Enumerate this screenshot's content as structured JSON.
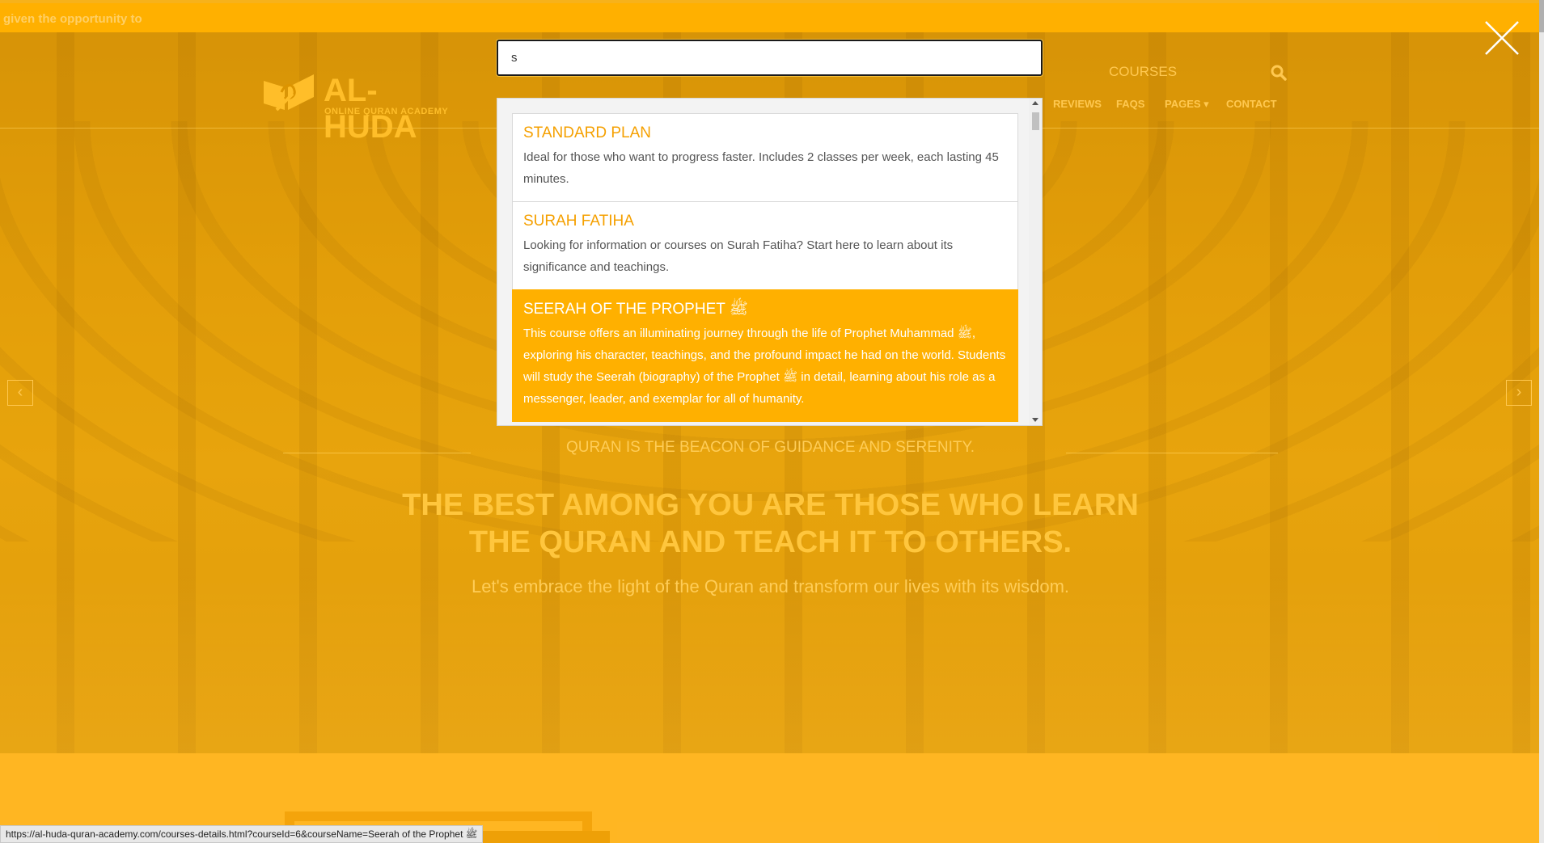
{
  "page": {
    "top_strip_text": "given the opportunity to",
    "logo": {
      "name": "AL-HUDA",
      "tagline": "ONLINE QURAN ACADEMY"
    },
    "nav": {
      "courses": "COURSES",
      "items": [
        {
          "label": "REVIEWS"
        },
        {
          "label": "FAQS"
        },
        {
          "label": "PAGES ▾"
        },
        {
          "label": "CONTACT"
        }
      ]
    },
    "hero": {
      "tagline": "QURAN IS THE BEACON OF GUIDANCE AND SERENITY.",
      "headline_line1": "THE BEST AMONG YOU ARE THOSE WHO LEARN",
      "headline_line2": "THE QURAN AND TEACH IT TO OTHERS.",
      "subline": "Let's embrace the light of the Quran and transform our lives with its wisdom.",
      "prev_arrow": "‹",
      "next_arrow": "›"
    }
  },
  "search": {
    "query": "s",
    "results": [
      {
        "title": "STANDARD PLAN",
        "description": "Ideal for those who want to progress faster. Includes 2 classes per week, each lasting 45 minutes.",
        "active": false
      },
      {
        "title": "SURAH FATIHA",
        "description": "Looking for information or courses on Surah Fatiha? Start here to learn about its significance and teachings.",
        "active": false
      },
      {
        "title": "SEERAH OF THE PROPHET ﷺ",
        "description": "This course offers an illuminating journey through the life of Prophet Muhammad ﷺ, exploring his character, teachings, and the profound impact he had on the world. Students will study the Seerah (biography) of the Prophet ﷺ in detail, learning about his role as a messenger, leader, and exemplar for all of humanity.",
        "active": true
      }
    ]
  },
  "status_bar": {
    "url": "https://al-huda-quran-academy.com/courses-details.html?courseId=6&courseName=Seerah of the Prophet ﷺ"
  },
  "colors": {
    "accent": "#ffb000",
    "result_title": "#f5a000",
    "overlay": "#ffaf00"
  },
  "icons": {
    "close": "close-icon",
    "search": "search-icon",
    "logo": "quran-book-logo-icon"
  }
}
